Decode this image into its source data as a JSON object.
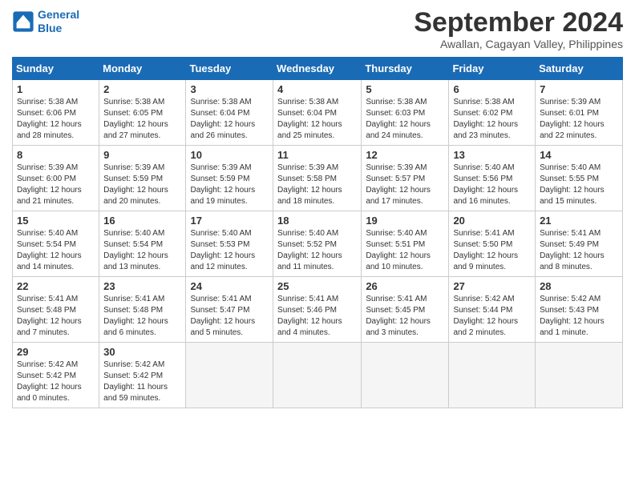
{
  "logo": {
    "line1": "General",
    "line2": "Blue"
  },
  "title": "September 2024",
  "subtitle": "Awallan, Cagayan Valley, Philippines",
  "weekdays": [
    "Sunday",
    "Monday",
    "Tuesday",
    "Wednesday",
    "Thursday",
    "Friday",
    "Saturday"
  ],
  "weeks": [
    [
      {
        "day": "1",
        "info": "Sunrise: 5:38 AM\nSunset: 6:06 PM\nDaylight: 12 hours\nand 28 minutes."
      },
      {
        "day": "2",
        "info": "Sunrise: 5:38 AM\nSunset: 6:05 PM\nDaylight: 12 hours\nand 27 minutes."
      },
      {
        "day": "3",
        "info": "Sunrise: 5:38 AM\nSunset: 6:04 PM\nDaylight: 12 hours\nand 26 minutes."
      },
      {
        "day": "4",
        "info": "Sunrise: 5:38 AM\nSunset: 6:04 PM\nDaylight: 12 hours\nand 25 minutes."
      },
      {
        "day": "5",
        "info": "Sunrise: 5:38 AM\nSunset: 6:03 PM\nDaylight: 12 hours\nand 24 minutes."
      },
      {
        "day": "6",
        "info": "Sunrise: 5:38 AM\nSunset: 6:02 PM\nDaylight: 12 hours\nand 23 minutes."
      },
      {
        "day": "7",
        "info": "Sunrise: 5:39 AM\nSunset: 6:01 PM\nDaylight: 12 hours\nand 22 minutes."
      }
    ],
    [
      {
        "day": "8",
        "info": "Sunrise: 5:39 AM\nSunset: 6:00 PM\nDaylight: 12 hours\nand 21 minutes."
      },
      {
        "day": "9",
        "info": "Sunrise: 5:39 AM\nSunset: 5:59 PM\nDaylight: 12 hours\nand 20 minutes."
      },
      {
        "day": "10",
        "info": "Sunrise: 5:39 AM\nSunset: 5:59 PM\nDaylight: 12 hours\nand 19 minutes."
      },
      {
        "day": "11",
        "info": "Sunrise: 5:39 AM\nSunset: 5:58 PM\nDaylight: 12 hours\nand 18 minutes."
      },
      {
        "day": "12",
        "info": "Sunrise: 5:39 AM\nSunset: 5:57 PM\nDaylight: 12 hours\nand 17 minutes."
      },
      {
        "day": "13",
        "info": "Sunrise: 5:40 AM\nSunset: 5:56 PM\nDaylight: 12 hours\nand 16 minutes."
      },
      {
        "day": "14",
        "info": "Sunrise: 5:40 AM\nSunset: 5:55 PM\nDaylight: 12 hours\nand 15 minutes."
      }
    ],
    [
      {
        "day": "15",
        "info": "Sunrise: 5:40 AM\nSunset: 5:54 PM\nDaylight: 12 hours\nand 14 minutes."
      },
      {
        "day": "16",
        "info": "Sunrise: 5:40 AM\nSunset: 5:54 PM\nDaylight: 12 hours\nand 13 minutes."
      },
      {
        "day": "17",
        "info": "Sunrise: 5:40 AM\nSunset: 5:53 PM\nDaylight: 12 hours\nand 12 minutes."
      },
      {
        "day": "18",
        "info": "Sunrise: 5:40 AM\nSunset: 5:52 PM\nDaylight: 12 hours\nand 11 minutes."
      },
      {
        "day": "19",
        "info": "Sunrise: 5:40 AM\nSunset: 5:51 PM\nDaylight: 12 hours\nand 10 minutes."
      },
      {
        "day": "20",
        "info": "Sunrise: 5:41 AM\nSunset: 5:50 PM\nDaylight: 12 hours\nand 9 minutes."
      },
      {
        "day": "21",
        "info": "Sunrise: 5:41 AM\nSunset: 5:49 PM\nDaylight: 12 hours\nand 8 minutes."
      }
    ],
    [
      {
        "day": "22",
        "info": "Sunrise: 5:41 AM\nSunset: 5:48 PM\nDaylight: 12 hours\nand 7 minutes."
      },
      {
        "day": "23",
        "info": "Sunrise: 5:41 AM\nSunset: 5:48 PM\nDaylight: 12 hours\nand 6 minutes."
      },
      {
        "day": "24",
        "info": "Sunrise: 5:41 AM\nSunset: 5:47 PM\nDaylight: 12 hours\nand 5 minutes."
      },
      {
        "day": "25",
        "info": "Sunrise: 5:41 AM\nSunset: 5:46 PM\nDaylight: 12 hours\nand 4 minutes."
      },
      {
        "day": "26",
        "info": "Sunrise: 5:41 AM\nSunset: 5:45 PM\nDaylight: 12 hours\nand 3 minutes."
      },
      {
        "day": "27",
        "info": "Sunrise: 5:42 AM\nSunset: 5:44 PM\nDaylight: 12 hours\nand 2 minutes."
      },
      {
        "day": "28",
        "info": "Sunrise: 5:42 AM\nSunset: 5:43 PM\nDaylight: 12 hours\nand 1 minute."
      }
    ],
    [
      {
        "day": "29",
        "info": "Sunrise: 5:42 AM\nSunset: 5:42 PM\nDaylight: 12 hours\nand 0 minutes."
      },
      {
        "day": "30",
        "info": "Sunrise: 5:42 AM\nSunset: 5:42 PM\nDaylight: 11 hours\nand 59 minutes."
      },
      {
        "day": "",
        "info": ""
      },
      {
        "day": "",
        "info": ""
      },
      {
        "day": "",
        "info": ""
      },
      {
        "day": "",
        "info": ""
      },
      {
        "day": "",
        "info": ""
      }
    ]
  ]
}
